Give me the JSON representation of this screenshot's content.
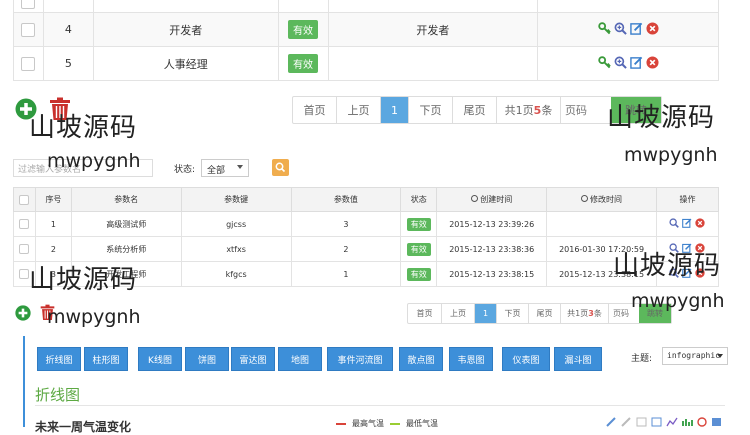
{
  "table1": {
    "rows": [
      {
        "num": "",
        "name": "",
        "status": "",
        "desc": ""
      },
      {
        "num": "4",
        "name": "开发者",
        "status": "有效",
        "desc": "开发者"
      },
      {
        "num": "5",
        "name": "人事经理",
        "status": "有效",
        "desc": ""
      }
    ]
  },
  "pager1": {
    "first": "首页",
    "prev": "上页",
    "current": "1",
    "next": "下页",
    "last": "尾页",
    "total_prefix": "共1页",
    "total_count": "5",
    "total_suffix": "条",
    "page_placeholder": "页码",
    "go": "跳转"
  },
  "watermark": {
    "text1": "山坡源码",
    "text2": "mwpygnh"
  },
  "filter": {
    "search_placeholder": "过滤输入参数名",
    "status_label": "状态:",
    "status_value": "全部"
  },
  "table2": {
    "headers": [
      "序号",
      "参数名",
      "参数键",
      "参数值",
      "状态",
      "创建时间",
      "修改时间",
      "操作"
    ],
    "rows": [
      {
        "num": "1",
        "name": "高级测试师",
        "key": "gjcss",
        "value": "3",
        "status": "有效",
        "created": "2015-12-13 23:39:26",
        "modified": ""
      },
      {
        "num": "2",
        "name": "系统分析师",
        "key": "xtfxs",
        "value": "2",
        "status": "有效",
        "created": "2015-12-13 23:38:36",
        "modified": "2016-01-30 17:20:59"
      },
      {
        "num": "3",
        "name": "开发工程师",
        "key": "kfgcs",
        "value": "1",
        "status": "有效",
        "created": "2015-12-13 23:38:15",
        "modified": "2015-12-13 23:38:15"
      }
    ]
  },
  "pager2": {
    "first": "首页",
    "prev": "上页",
    "current": "1",
    "next": "下页",
    "last": "尾页",
    "total_prefix": "共1页",
    "total_count": "3",
    "total_suffix": "条",
    "page_placeholder": "页码",
    "go": "跳转"
  },
  "charts": {
    "buttons": [
      "折线图",
      "柱形图",
      "K线图",
      "饼图",
      "雷达图",
      "地图",
      "事件河流图",
      "散点图",
      "韦恩图",
      "仪表图",
      "漏斗图"
    ],
    "theme_label": "主题:",
    "theme_value": "infographic",
    "section_title": "折线图",
    "chart_title": "未来一周气温变化",
    "legend_high": "最高气温",
    "legend_low": "最低气温"
  }
}
